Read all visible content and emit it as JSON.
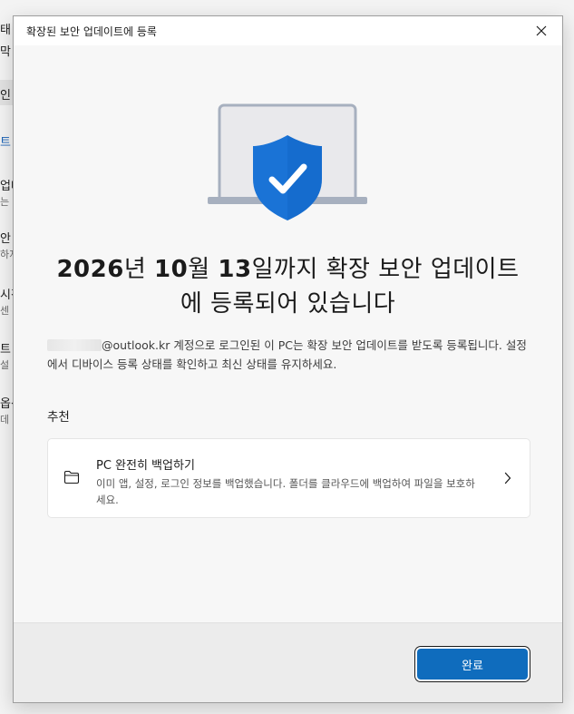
{
  "background_app": {
    "fragments": [
      "태",
      "막",
      "인",
      "트",
      "업데",
      "는",
      "안",
      "하지",
      "시간",
      "센",
      "트",
      "설",
      "옵션",
      "데"
    ]
  },
  "dialog": {
    "title": "확장된 보안 업데이트에 등록",
    "headline": {
      "year": "2026",
      "year_suffix": "년 ",
      "month": "10",
      "month_suffix": "월 ",
      "day": "13",
      "line1_rest": "일까지 확장 보안 업데이트",
      "line2": "에 등록되어 있습니다"
    },
    "body": {
      "account_suffix": "@outlook.kr",
      "text": " 계정으로 로그인된 이 PC는 확장 보안 업데이트를 받도록 등록됩니다. 설정에서 디바이스 등록 상태를 확인하고 최신 상태를 유지하세요."
    },
    "section_label": "추천",
    "recommendation": {
      "title": "PC 완전히 백업하기",
      "description": "이미 앱, 설정, 로그인 정보를 백업했습니다. 폴더를 클라우드에 백업하여 파일을 보호하세요.",
      "icon": "folder-icon"
    },
    "done_button": "완료"
  },
  "colors": {
    "accent": "#0f6cbd",
    "shield": "#1a73d6",
    "laptop_body": "#e9e9ec",
    "laptop_frame": "#a7b0bf"
  }
}
